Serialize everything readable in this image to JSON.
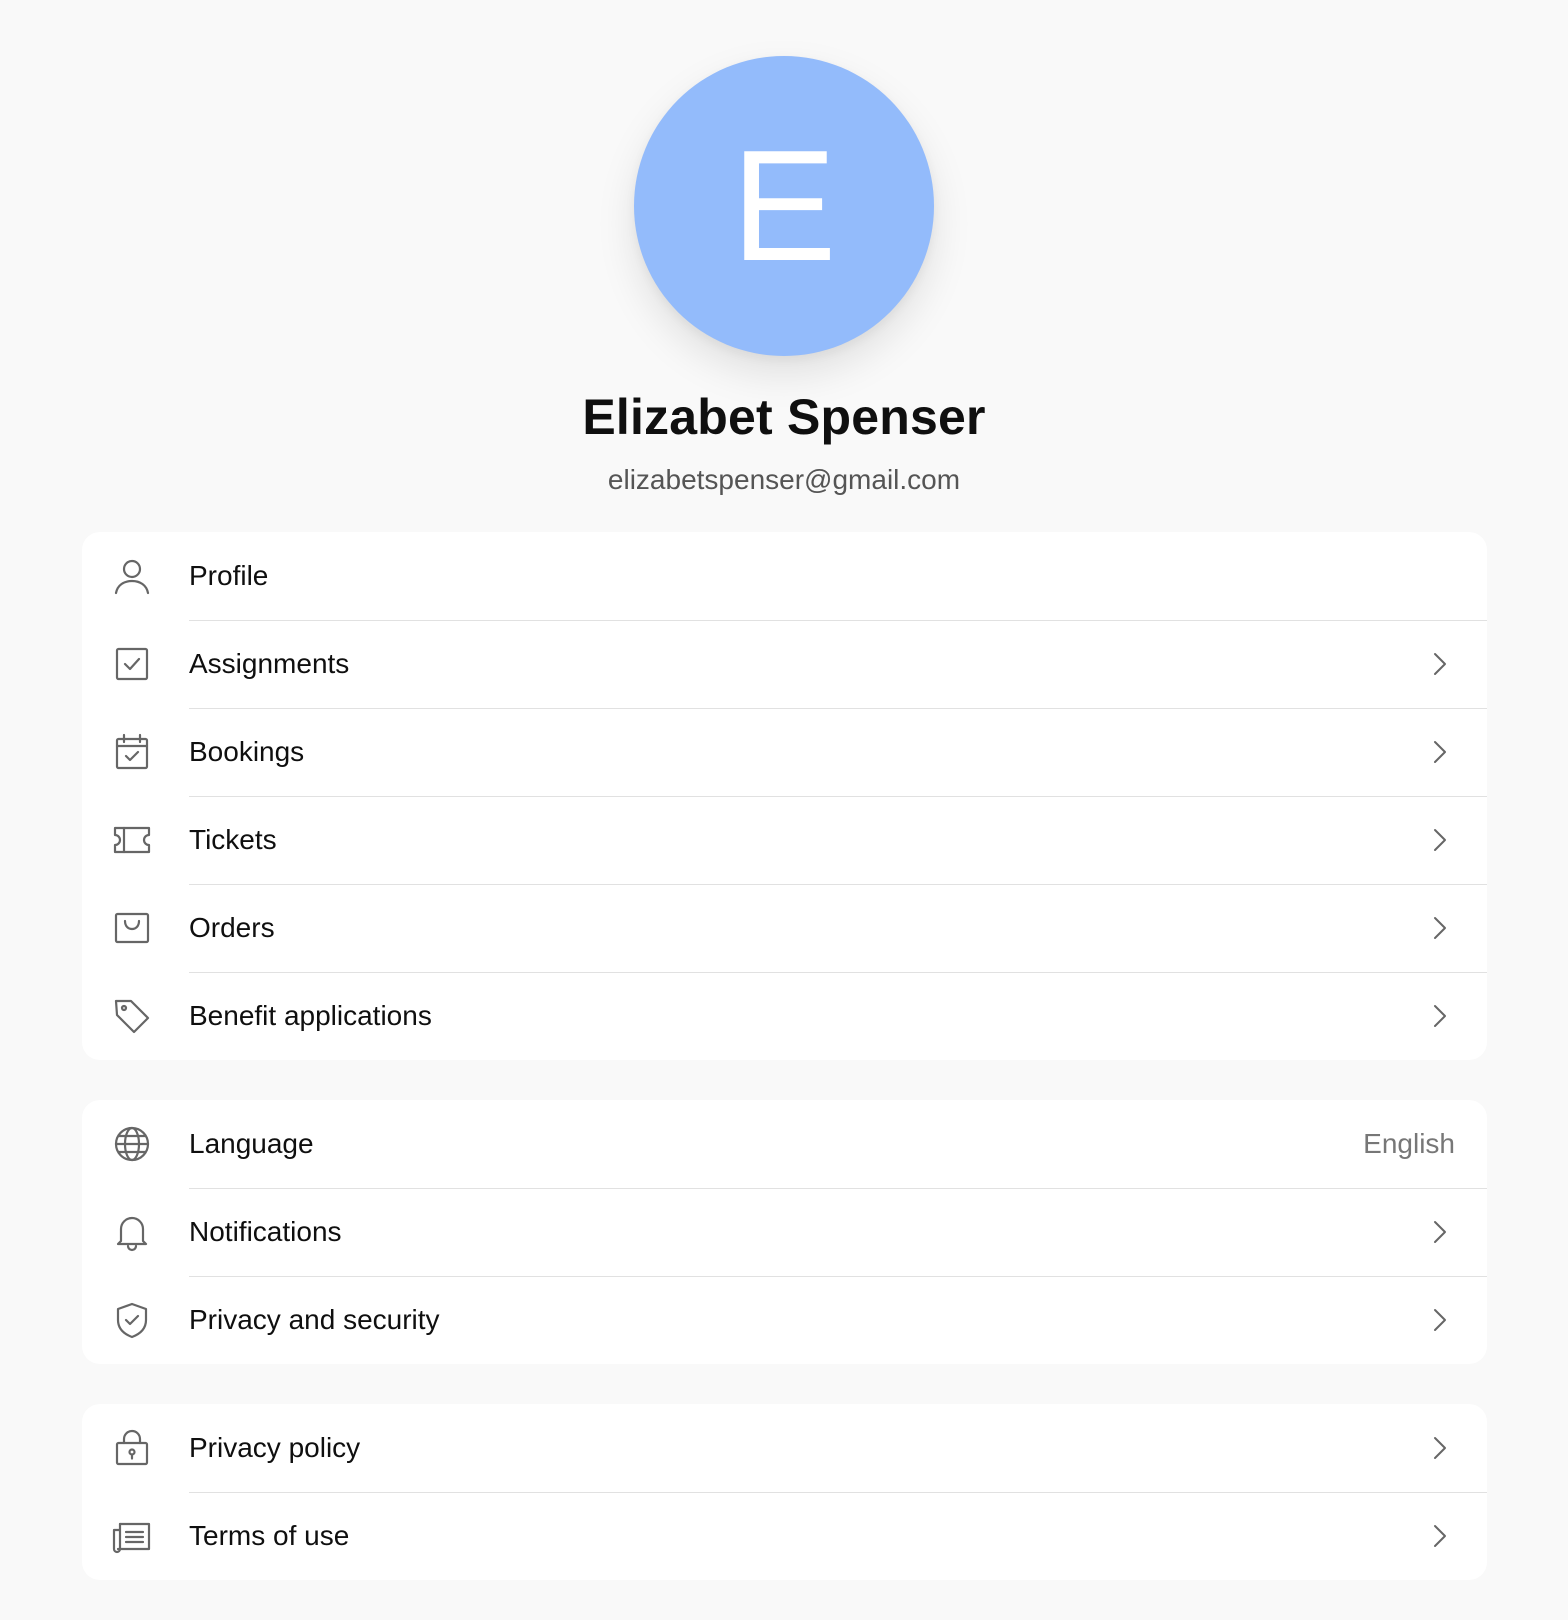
{
  "user": {
    "initial": "E",
    "name": "Elizabet Spenser",
    "email": "elizabetspenser@gmail.com",
    "avatar_color": "#93bbfb"
  },
  "sections": {
    "account": [
      {
        "label": "Profile",
        "icon": "user-icon",
        "chevron": false
      },
      {
        "label": "Assignments",
        "icon": "checkbox-icon",
        "chevron": true
      },
      {
        "label": "Bookings",
        "icon": "calendar-check-icon",
        "chevron": true
      },
      {
        "label": "Tickets",
        "icon": "ticket-icon",
        "chevron": true
      },
      {
        "label": "Orders",
        "icon": "shopping-bag-icon",
        "chevron": true
      },
      {
        "label": "Benefit applications",
        "icon": "tag-icon",
        "chevron": true
      }
    ],
    "settings": [
      {
        "label": "Language",
        "icon": "globe-icon",
        "value": "English"
      },
      {
        "label": "Notifications",
        "icon": "bell-icon",
        "chevron": true
      },
      {
        "label": "Privacy and security",
        "icon": "shield-check-icon",
        "chevron": true
      }
    ],
    "legal": [
      {
        "label": "Privacy policy",
        "icon": "lock-icon",
        "chevron": true
      },
      {
        "label": "Terms of use",
        "icon": "document-list-icon",
        "chevron": true
      }
    ]
  },
  "colors": {
    "background": "#f9f9f9",
    "card": "#ffffff",
    "divider": "#e1e1e1",
    "icon": "#666666"
  }
}
